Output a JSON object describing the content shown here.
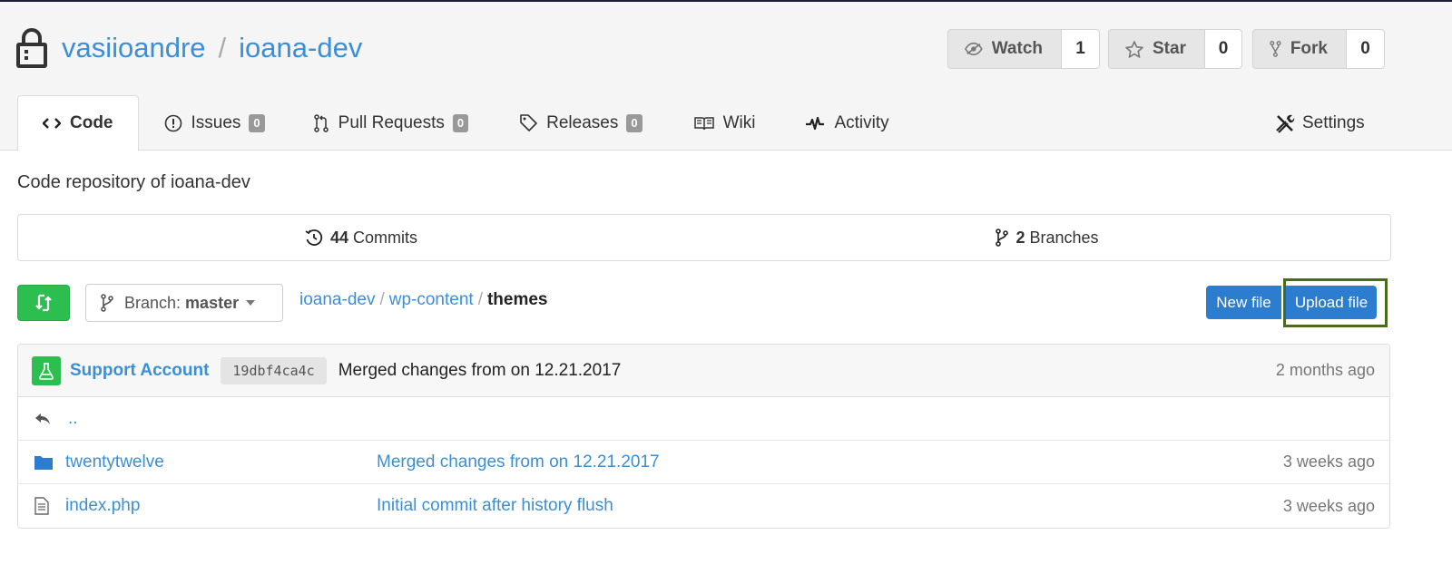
{
  "repo": {
    "owner": "vasiioandre",
    "separator": "/",
    "name": "ioana-dev",
    "description": "Code repository of ioana-dev"
  },
  "social": {
    "watch_label": "Watch",
    "watch_count": "1",
    "star_label": "Star",
    "star_count": "0",
    "fork_label": "Fork",
    "fork_count": "0"
  },
  "tabs": [
    {
      "label": "Code",
      "icon": "code-icon",
      "active": true
    },
    {
      "label": "Issues",
      "icon": "issue-icon",
      "badge": "0"
    },
    {
      "label": "Pull Requests",
      "icon": "pull-request-icon",
      "badge": "0"
    },
    {
      "label": "Releases",
      "icon": "tag-icon",
      "badge": "0"
    },
    {
      "label": "Wiki",
      "icon": "book-icon"
    },
    {
      "label": "Activity",
      "icon": "pulse-icon"
    },
    {
      "label": "Settings",
      "icon": "tools-icon"
    }
  ],
  "stats": {
    "commits_count": "44",
    "commits_label": "Commits",
    "branches_count": "2",
    "branches_label": "Branches"
  },
  "branch": {
    "label": "Branch:",
    "name": "master"
  },
  "breadcrumb": {
    "root": "ioana-dev",
    "sep": "/",
    "mid": "wp-content",
    "current": "themes"
  },
  "actions": {
    "new_file": "New file",
    "upload_file": "Upload file"
  },
  "latest_commit": {
    "author": "Support Account",
    "sha": "19dbf4ca4c",
    "message": "Merged changes from on 12.21.2017",
    "time": "2 months ago"
  },
  "files": [
    {
      "name": "..",
      "icon": "reply-icon"
    },
    {
      "name": "twentytwelve",
      "icon": "folder-icon",
      "message": "Merged changes from on 12.21.2017",
      "time": "3 weeks ago"
    },
    {
      "name": "index.php",
      "icon": "file-icon",
      "message": "Initial commit after history flush",
      "time": "3 weeks ago"
    }
  ],
  "colors": {
    "link": "#3b8fd6",
    "primary_button": "#2c7cd0",
    "success": "#2cbe4e",
    "highlight_border": "#4a6a1c"
  }
}
